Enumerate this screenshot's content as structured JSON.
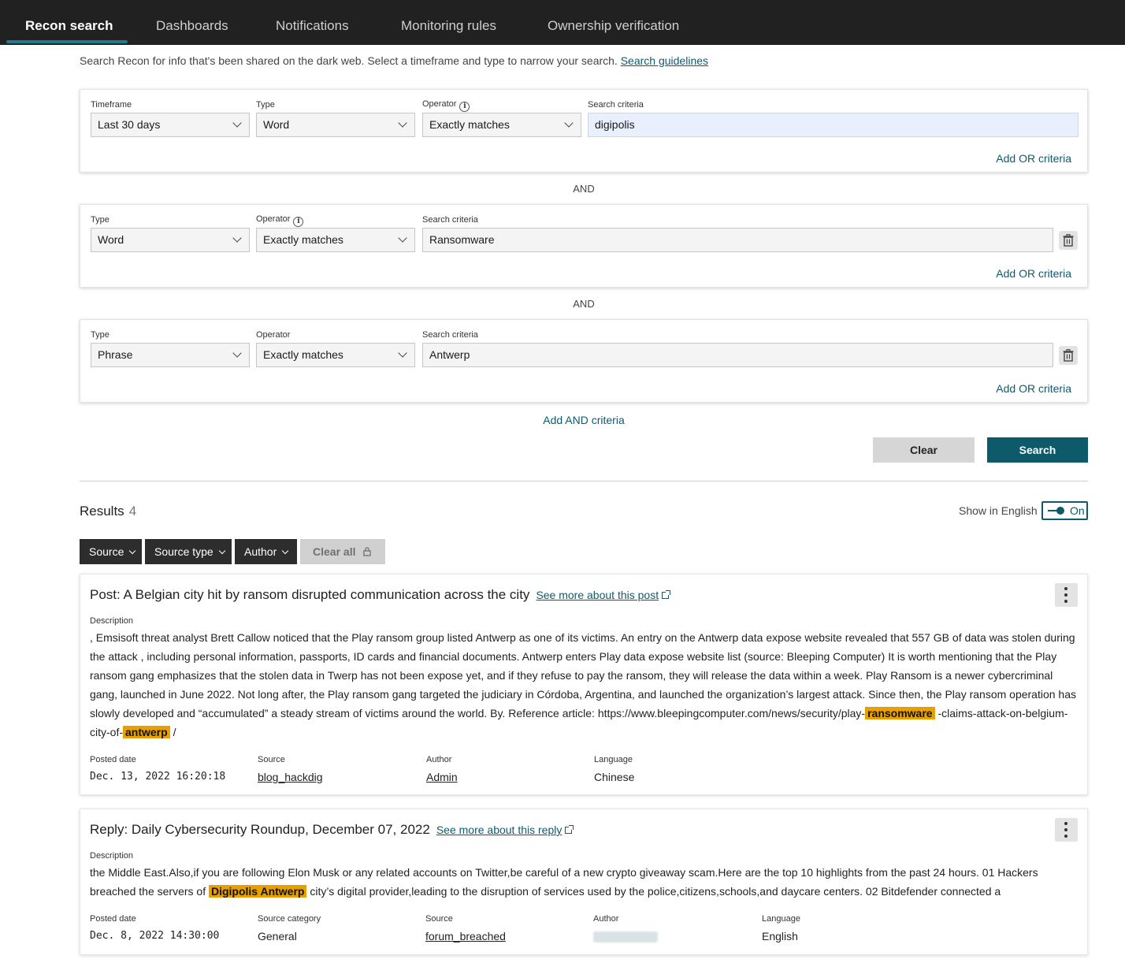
{
  "nav": {
    "tabs": [
      "Recon search",
      "Dashboards",
      "Notifications",
      "Monitoring rules",
      "Ownership verification"
    ]
  },
  "intro": {
    "text": "Search Recon for info that's been shared on the dark web. Select a timeframe and type to narrow your search.",
    "link": "Search guidelines"
  },
  "criteria": {
    "group1": {
      "timeframe_label": "Timeframe",
      "timeframe": "Last 30 days",
      "type_label": "Type",
      "type": "Word",
      "operator_label": "Operator",
      "operator": "Exactly matches",
      "search_label": "Search criteria",
      "search": "digipolis",
      "add_or": "Add OR criteria"
    },
    "and_label": "AND",
    "group2": {
      "type_label": "Type",
      "type": "Word",
      "operator_label": "Operator",
      "operator": "Exactly matches",
      "search_label": "Search criteria",
      "search": "Ransomware",
      "add_or": "Add OR criteria"
    },
    "group3": {
      "type_label": "Type",
      "type": "Phrase",
      "operator_label": "Operator",
      "operator": "Exactly matches",
      "search_label": "Search criteria",
      "search": "Antwerp",
      "add_or": "Add OR criteria"
    },
    "add_and": "Add AND criteria",
    "clear_button": "Clear",
    "search_button": "Search"
  },
  "results": {
    "title": "Results",
    "count": "4",
    "show_in_english": "Show in English",
    "toggle": "On",
    "filters": [
      "Source",
      "Source type",
      "Author"
    ],
    "clear_all": "Clear all"
  },
  "result1": {
    "title": "Post: A Belgian city hit by ransom disrupted communication across the city",
    "link": "See more about this post",
    "description_label": "Description",
    "desc_a": ", Emsisoft threat analyst Brett Callow noticed that the Play ransom group listed Antwerp as one of its victims. An entry on the Antwerp data expose website revealed that 557 GB of data was stolen during the attack , including personal information, passports, ID cards and financial documents. Antwerp enters Play data expose website list (source: Bleeping Computer) It is worth mentioning that the Play ransom gang emphasizes that the stolen data in Twerp has not been expose yet, and if they refuse to pay the ransom, they will release the data within a week. Play Ransom is a newer cybercriminal gang, launched in June 2022. Not long after, the Play ransom gang targeted the judiciary in Córdoba, Argentina, and launched the organization’s largest attack. Since then, the Play ransom operation has slowly developed and “accumulated” a steady stream of victims around the world. By. Reference article: https://www.bleepingcomputer.com/news/security/play-",
    "hl1": "ransomware",
    "desc_b": "-claims-attack-on-belgium-city-of-",
    "hl2": "antwerp",
    "desc_c": "/",
    "posted_label": "Posted date",
    "posted": "Dec. 13, 2022 16:20:18",
    "source_label": "Source",
    "source": "blog_hackdig",
    "author_label": "Author",
    "author": "Admin",
    "language_label": "Language",
    "language": "Chinese"
  },
  "result2": {
    "title": "Reply: Daily Cybersecurity Roundup, December 07, 2022",
    "link": "See more about this reply",
    "description_label": "Description",
    "desc_a": "the Middle East.Also,if you are following Elon Musk or any related accounts on Twitter,be careful of a new crypto giveaway scam.Here are the top 10 highlights from the past 24 hours. 01 Hackers breached the servers of",
    "hl1": "Digipolis Antwerp",
    "desc_b": "city’s digital provider,leading to the disruption of services used by the police,citizens,schools,and daycare centers. 02 Bitdefender connected a",
    "posted_label": "Posted date",
    "posted": "Dec. 8, 2022 14:30:00",
    "category_label": "Source category",
    "category": "General",
    "source_label": "Source",
    "source": "forum_breached",
    "author_label": "Author",
    "language_label": "Language",
    "language": "English"
  },
  "colors": {
    "accent": "#0d5a6a",
    "highlight": "#e8a000",
    "nav_bg": "#212121"
  }
}
